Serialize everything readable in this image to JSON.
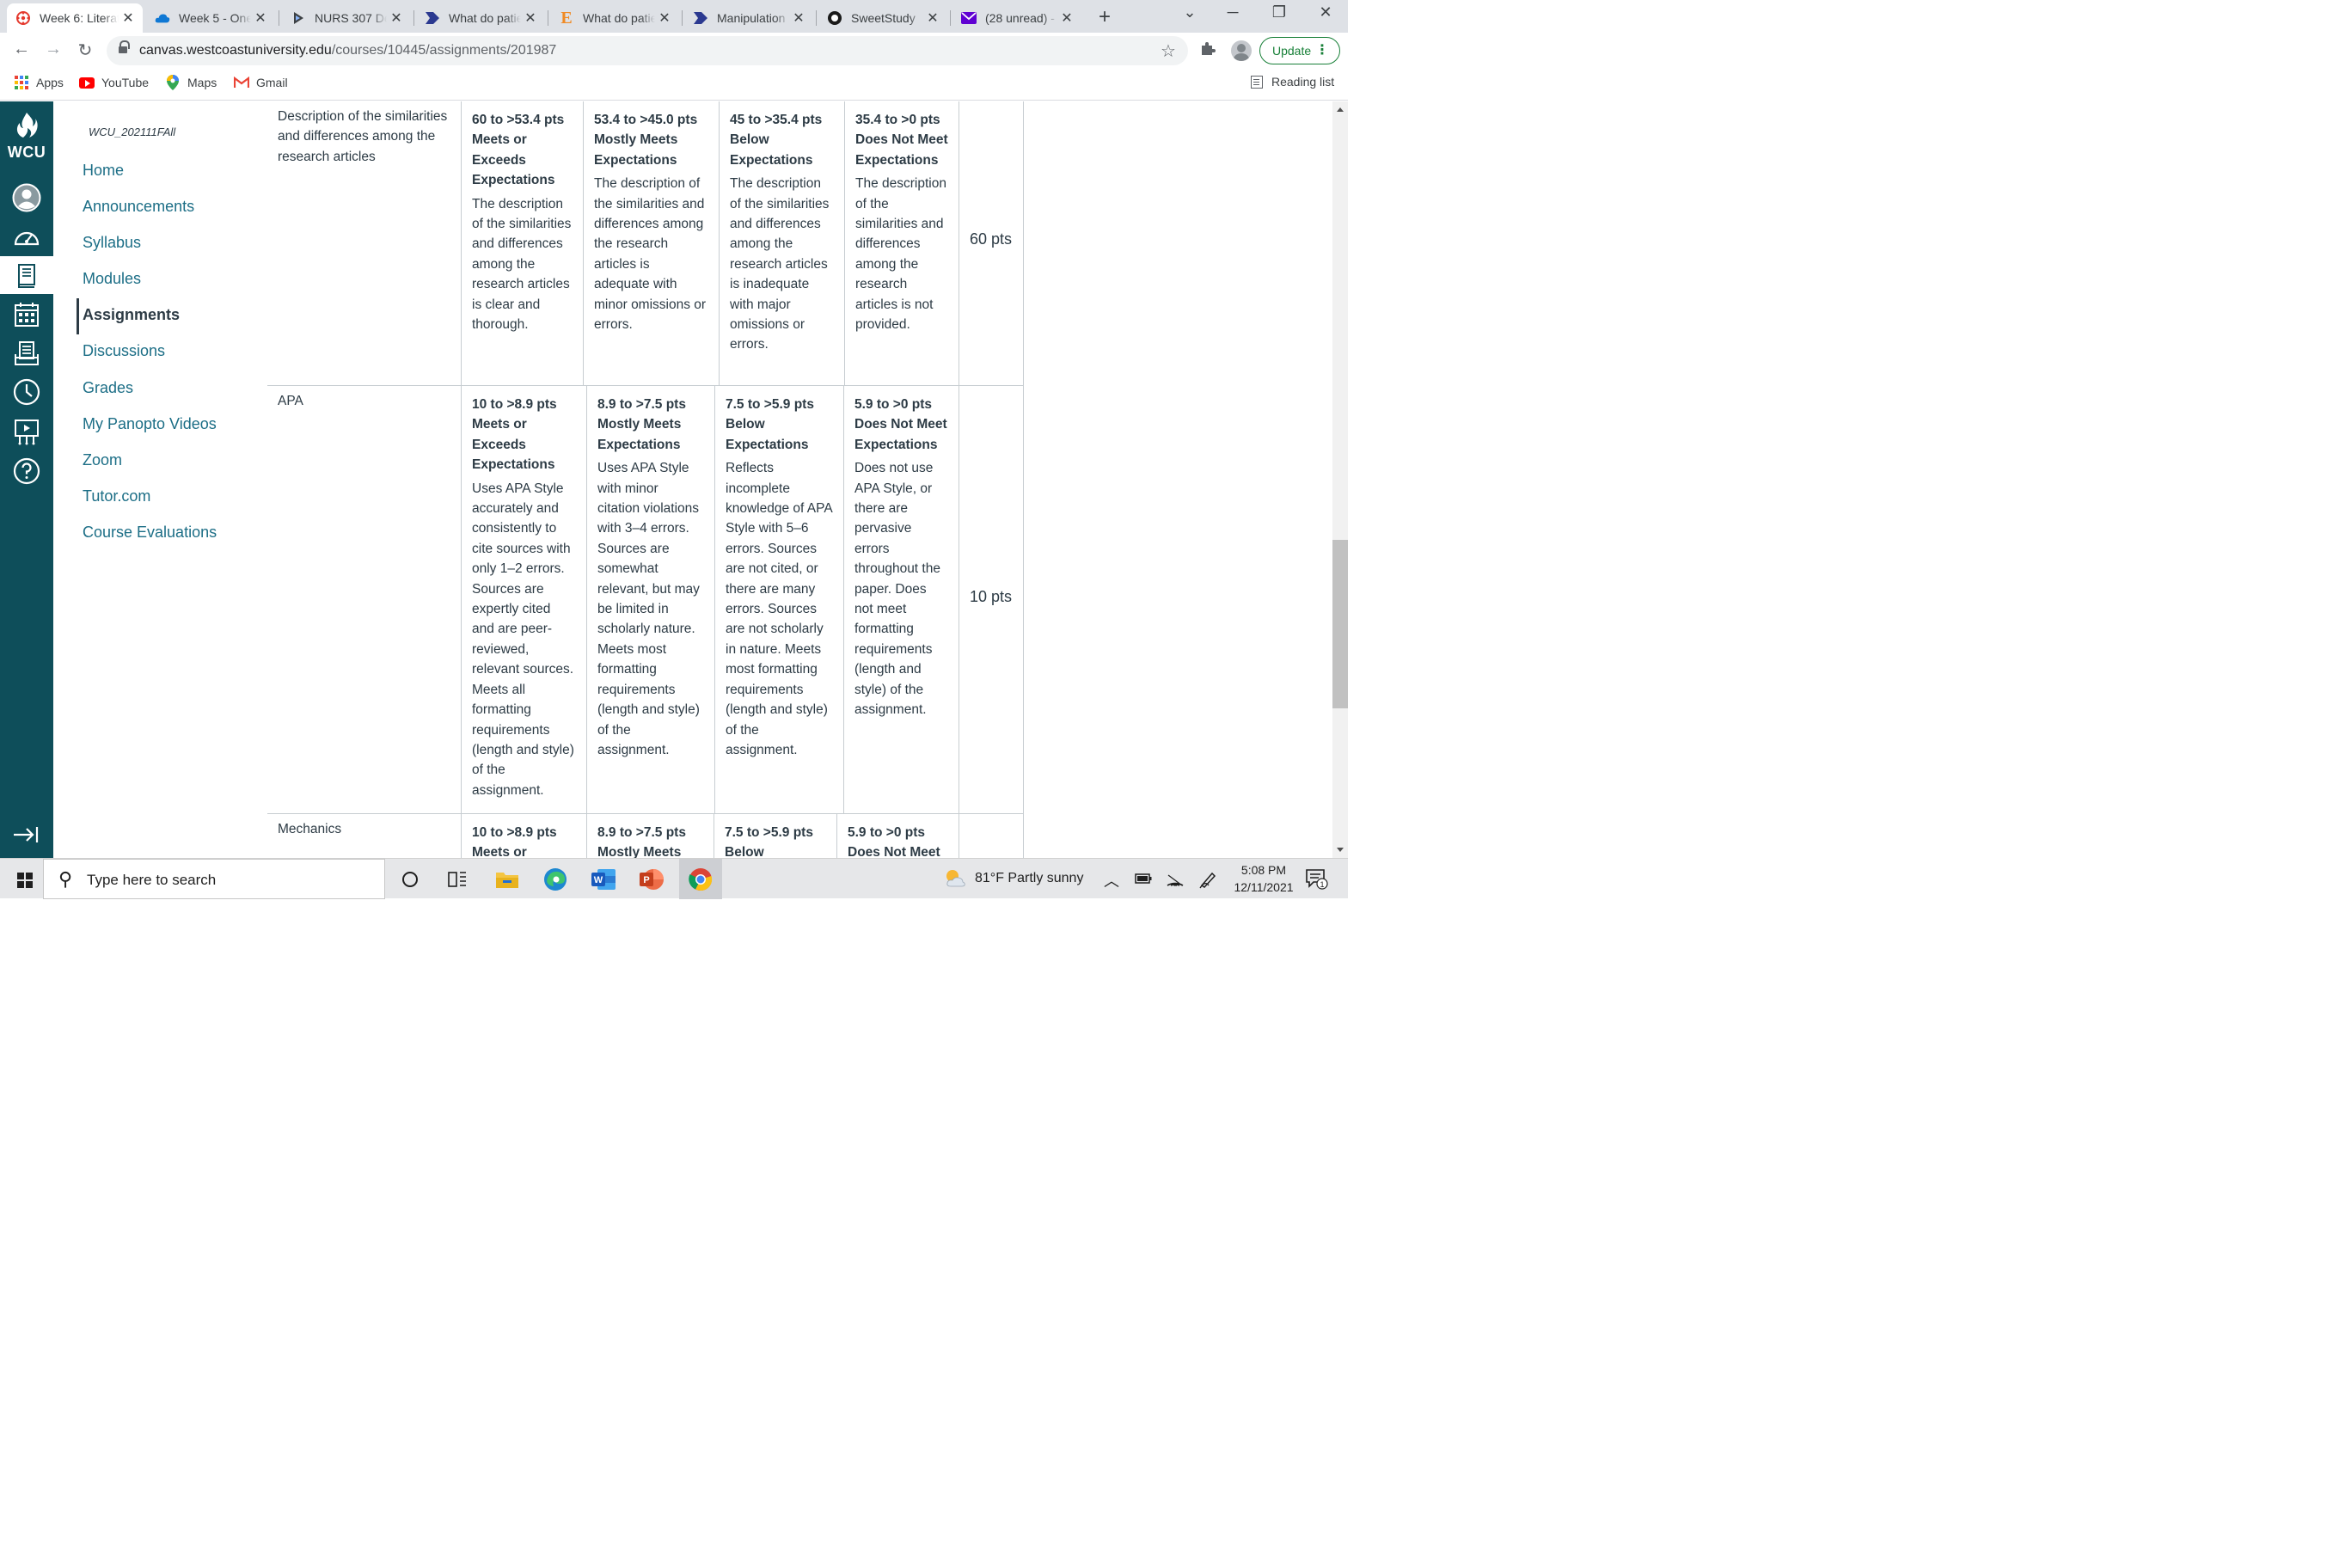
{
  "browser": {
    "tabs": [
      {
        "title": "Week 6: Literat",
        "active": true
      },
      {
        "title": "Week 5 - OneD"
      },
      {
        "title": "NURS 307 Des"
      },
      {
        "title": "What do patie"
      },
      {
        "title": "What do patie"
      },
      {
        "title": "Manipulation"
      },
      {
        "title": "SweetStudy"
      },
      {
        "title": "(28 unread) - "
      }
    ],
    "url_domain": "canvas.westcoastuniversity.edu",
    "url_path": "/courses/10445/assignments/201987",
    "update_label": "Update",
    "bookmarks": [
      "Apps",
      "YouTube",
      "Maps",
      "Gmail"
    ],
    "reading_list": "Reading list"
  },
  "global_nav": {
    "logo_text": "WCU"
  },
  "course_nav": {
    "course_code": "WCU_202111FAll",
    "items": [
      "Home",
      "Announcements",
      "Syllabus",
      "Modules",
      "Assignments",
      "Discussions",
      "Grades",
      "My Panopto Videos",
      "Zoom",
      "Tutor.com",
      "Course Evaluations"
    ],
    "active_index": 4
  },
  "rubric": {
    "rows": [
      {
        "criterion": "Description of the similarities and differences among the research articles",
        "points": "60 pts",
        "ratings": [
          {
            "pts": "60 to >53.4 pts",
            "title": "Meets or Exceeds Expectations",
            "desc": "The description of the similarities and differences among the research articles is clear and thorough."
          },
          {
            "pts": "53.4 to >45.0 pts",
            "title": "Mostly Meets Expectations",
            "desc": "The description of the similarities and differences among the research articles is adequate with minor omissions or errors."
          },
          {
            "pts": "45 to >35.4 pts",
            "title": "Below Expectations",
            "desc": "The description of the similarities and differences among the research articles is inadequate with major omissions or errors."
          },
          {
            "pts": "35.4 to >0 pts",
            "title": "Does Not Meet Expectations",
            "desc": "The description of the similarities and differences among the research articles is not provided."
          }
        ]
      },
      {
        "criterion": "APA",
        "points": "10 pts",
        "ratings": [
          {
            "pts": "10 to >8.9 pts",
            "title": "Meets or Exceeds Expectations",
            "desc": "Uses APA Style accurately and consistently to cite sources with only 1–2 errors. Sources are expertly cited and are peer-reviewed, relevant sources. Meets all formatting requirements (length and style) of the assignment."
          },
          {
            "pts": "8.9 to >7.5 pts",
            "title": "Mostly Meets Expectations",
            "desc": "Uses APA Style with minor citation violations with 3–4 errors. Sources are somewhat relevant, but may be limited in scholarly nature. Meets most formatting requirements (length and style) of the assignment."
          },
          {
            "pts": "7.5 to >5.9 pts",
            "title": "Below Expectations",
            "desc": "Reflects incomplete knowledge of APA Style with 5–6 errors. Sources are not cited, or there are many errors. Sources are not scholarly in nature. Meets most formatting requirements (length and style) of the assignment."
          },
          {
            "pts": "5.9 to >0 pts",
            "title": "Does Not Meet Expectations",
            "desc": "Does not use APA Style, or there are pervasive errors throughout the paper. Does not meet formatting requirements (length and style) of the assignment."
          }
        ]
      },
      {
        "criterion": "Mechanics",
        "points": "",
        "ratings": [
          {
            "pts": "10 to >8.9 pts",
            "title": "Meets or",
            "desc": ""
          },
          {
            "pts": "8.9 to >7.5 pts",
            "title": "Mostly Meets",
            "desc": ""
          },
          {
            "pts": "7.5 to >5.9 pts",
            "title": "Below",
            "desc": ""
          },
          {
            "pts": "5.9 to >0 pts",
            "title": "Does Not Meet",
            "desc": ""
          }
        ]
      }
    ]
  },
  "taskbar": {
    "search_placeholder": "Type here to search",
    "weather": "81°F  Partly sunny",
    "time": "5:08 PM",
    "date": "12/11/2021",
    "notification_count": "1"
  }
}
